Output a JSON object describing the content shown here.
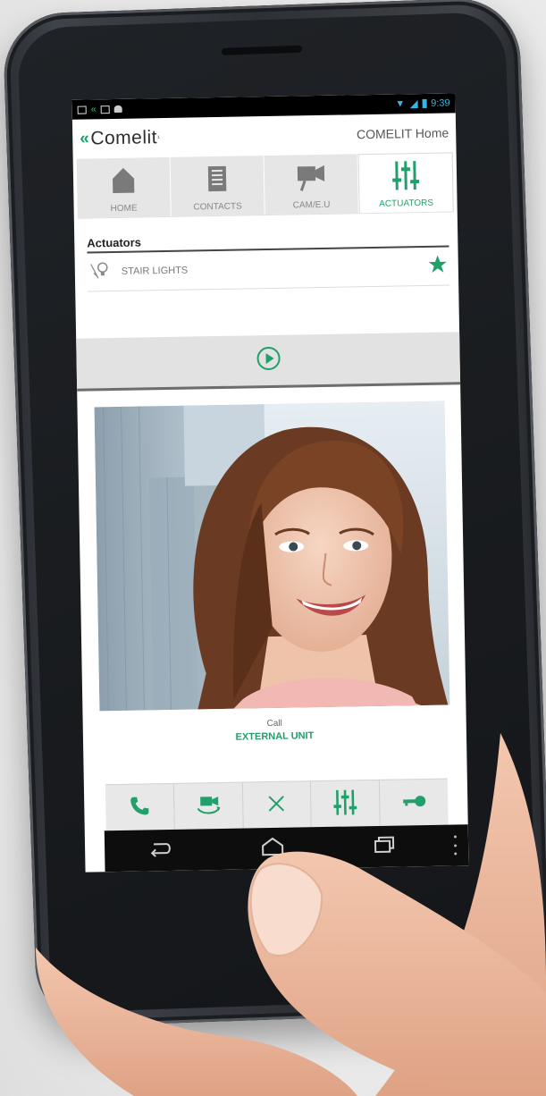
{
  "statusbar": {
    "time": "9:39",
    "left_icons": [
      "image-icon",
      "back-icon",
      "sim-icon",
      "android-icon"
    ],
    "right_icons": [
      "wifi-icon",
      "signal-icon",
      "battery-icon"
    ]
  },
  "header": {
    "logo_text": "Comelit",
    "title": "COMELIT Home"
  },
  "tabs": [
    {
      "label": "HOME",
      "icon": "home-icon",
      "active": false
    },
    {
      "label": "CONTACTS",
      "icon": "contacts-icon",
      "active": false
    },
    {
      "label": "CAM/E.U",
      "icon": "camera-icon",
      "active": false
    },
    {
      "label": "ACTUATORS",
      "icon": "sliders-icon",
      "active": true
    }
  ],
  "actuators": {
    "section_title": "Actuators",
    "items": [
      {
        "label": "STAIR LIGHTS",
        "icon": "bulb-icon",
        "favorite": true
      }
    ]
  },
  "player": {
    "icon": "play-icon"
  },
  "call": {
    "label": "Call",
    "unit": "EXTERNAL UNIT",
    "buttons": [
      {
        "icon": "phone-icon"
      },
      {
        "icon": "switch-camera-icon"
      },
      {
        "icon": "close-icon"
      },
      {
        "icon": "sliders-icon"
      },
      {
        "icon": "key-icon"
      }
    ]
  },
  "nav": {
    "buttons": [
      {
        "icon": "back-icon"
      },
      {
        "icon": "home-icon"
      },
      {
        "icon": "recent-apps-icon"
      },
      {
        "icon": "menu-icon"
      }
    ]
  },
  "colors": {
    "accent": "#21a06a",
    "status_blue": "#33b5e5",
    "tab_inactive": "#e6e6e6",
    "navbar": "#0d0d0d"
  }
}
